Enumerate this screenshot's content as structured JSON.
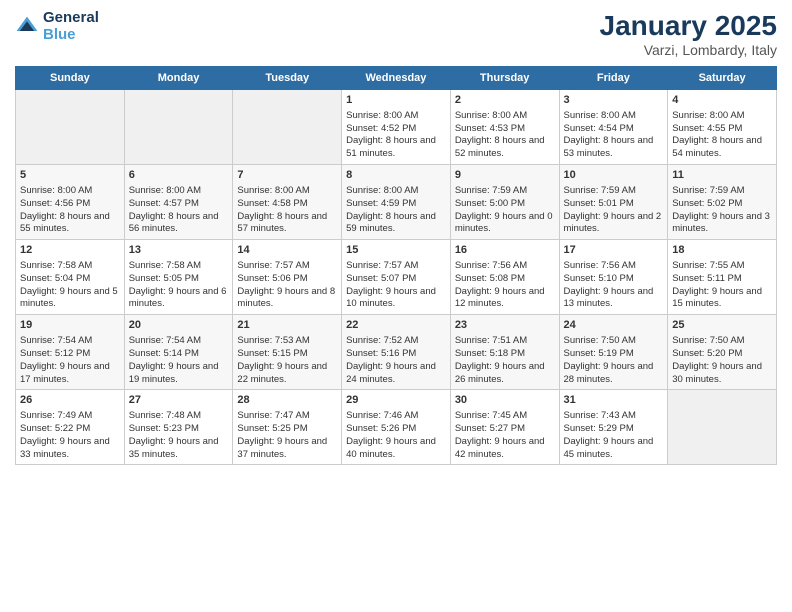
{
  "header": {
    "logo_line1": "General",
    "logo_line2": "Blue",
    "main_title": "January 2025",
    "subtitle": "Varzi, Lombardy, Italy"
  },
  "days_of_week": [
    "Sunday",
    "Monday",
    "Tuesday",
    "Wednesday",
    "Thursday",
    "Friday",
    "Saturday"
  ],
  "weeks": [
    [
      {
        "day": "",
        "empty": true
      },
      {
        "day": "",
        "empty": true
      },
      {
        "day": "",
        "empty": true
      },
      {
        "day": "1",
        "sunrise": "8:00 AM",
        "sunset": "4:52 PM",
        "daylight": "8 hours and 51 minutes."
      },
      {
        "day": "2",
        "sunrise": "8:00 AM",
        "sunset": "4:53 PM",
        "daylight": "8 hours and 52 minutes."
      },
      {
        "day": "3",
        "sunrise": "8:00 AM",
        "sunset": "4:54 PM",
        "daylight": "8 hours and 53 minutes."
      },
      {
        "day": "4",
        "sunrise": "8:00 AM",
        "sunset": "4:55 PM",
        "daylight": "8 hours and 54 minutes."
      }
    ],
    [
      {
        "day": "5",
        "sunrise": "8:00 AM",
        "sunset": "4:56 PM",
        "daylight": "8 hours and 55 minutes."
      },
      {
        "day": "6",
        "sunrise": "8:00 AM",
        "sunset": "4:57 PM",
        "daylight": "8 hours and 56 minutes."
      },
      {
        "day": "7",
        "sunrise": "8:00 AM",
        "sunset": "4:58 PM",
        "daylight": "8 hours and 57 minutes."
      },
      {
        "day": "8",
        "sunrise": "8:00 AM",
        "sunset": "4:59 PM",
        "daylight": "8 hours and 59 minutes."
      },
      {
        "day": "9",
        "sunrise": "7:59 AM",
        "sunset": "5:00 PM",
        "daylight": "9 hours and 0 minutes."
      },
      {
        "day": "10",
        "sunrise": "7:59 AM",
        "sunset": "5:01 PM",
        "daylight": "9 hours and 2 minutes."
      },
      {
        "day": "11",
        "sunrise": "7:59 AM",
        "sunset": "5:02 PM",
        "daylight": "9 hours and 3 minutes."
      }
    ],
    [
      {
        "day": "12",
        "sunrise": "7:58 AM",
        "sunset": "5:04 PM",
        "daylight": "9 hours and 5 minutes."
      },
      {
        "day": "13",
        "sunrise": "7:58 AM",
        "sunset": "5:05 PM",
        "daylight": "9 hours and 6 minutes."
      },
      {
        "day": "14",
        "sunrise": "7:57 AM",
        "sunset": "5:06 PM",
        "daylight": "9 hours and 8 minutes."
      },
      {
        "day": "15",
        "sunrise": "7:57 AM",
        "sunset": "5:07 PM",
        "daylight": "9 hours and 10 minutes."
      },
      {
        "day": "16",
        "sunrise": "7:56 AM",
        "sunset": "5:08 PM",
        "daylight": "9 hours and 12 minutes."
      },
      {
        "day": "17",
        "sunrise": "7:56 AM",
        "sunset": "5:10 PM",
        "daylight": "9 hours and 13 minutes."
      },
      {
        "day": "18",
        "sunrise": "7:55 AM",
        "sunset": "5:11 PM",
        "daylight": "9 hours and 15 minutes."
      }
    ],
    [
      {
        "day": "19",
        "sunrise": "7:54 AM",
        "sunset": "5:12 PM",
        "daylight": "9 hours and 17 minutes."
      },
      {
        "day": "20",
        "sunrise": "7:54 AM",
        "sunset": "5:14 PM",
        "daylight": "9 hours and 19 minutes."
      },
      {
        "day": "21",
        "sunrise": "7:53 AM",
        "sunset": "5:15 PM",
        "daylight": "9 hours and 22 minutes."
      },
      {
        "day": "22",
        "sunrise": "7:52 AM",
        "sunset": "5:16 PM",
        "daylight": "9 hours and 24 minutes."
      },
      {
        "day": "23",
        "sunrise": "7:51 AM",
        "sunset": "5:18 PM",
        "daylight": "9 hours and 26 minutes."
      },
      {
        "day": "24",
        "sunrise": "7:50 AM",
        "sunset": "5:19 PM",
        "daylight": "9 hours and 28 minutes."
      },
      {
        "day": "25",
        "sunrise": "7:50 AM",
        "sunset": "5:20 PM",
        "daylight": "9 hours and 30 minutes."
      }
    ],
    [
      {
        "day": "26",
        "sunrise": "7:49 AM",
        "sunset": "5:22 PM",
        "daylight": "9 hours and 33 minutes."
      },
      {
        "day": "27",
        "sunrise": "7:48 AM",
        "sunset": "5:23 PM",
        "daylight": "9 hours and 35 minutes."
      },
      {
        "day": "28",
        "sunrise": "7:47 AM",
        "sunset": "5:25 PM",
        "daylight": "9 hours and 37 minutes."
      },
      {
        "day": "29",
        "sunrise": "7:46 AM",
        "sunset": "5:26 PM",
        "daylight": "9 hours and 40 minutes."
      },
      {
        "day": "30",
        "sunrise": "7:45 AM",
        "sunset": "5:27 PM",
        "daylight": "9 hours and 42 minutes."
      },
      {
        "day": "31",
        "sunrise": "7:43 AM",
        "sunset": "5:29 PM",
        "daylight": "9 hours and 45 minutes."
      },
      {
        "day": "",
        "empty": true
      }
    ]
  ]
}
